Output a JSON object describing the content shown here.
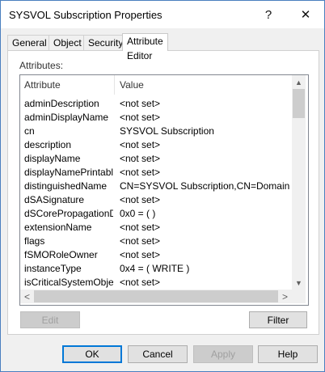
{
  "window": {
    "title": "SYSVOL Subscription Properties",
    "help_glyph": "?",
    "close_glyph": "✕"
  },
  "tabs": [
    {
      "label": "General"
    },
    {
      "label": "Object"
    },
    {
      "label": "Security"
    },
    {
      "label": "Attribute Editor",
      "active": true
    }
  ],
  "editor": {
    "section_label": "Attributes:",
    "columns": {
      "attribute": "Attribute",
      "value": "Value"
    },
    "rows": [
      {
        "name": "adminDescription",
        "value": "<not set>"
      },
      {
        "name": "adminDisplayName",
        "value": "<not set>"
      },
      {
        "name": "cn",
        "value": "SYSVOL Subscription"
      },
      {
        "name": "description",
        "value": "<not set>"
      },
      {
        "name": "displayName",
        "value": "<not set>"
      },
      {
        "name": "displayNamePrintable",
        "value": "<not set>"
      },
      {
        "name": "distinguishedName",
        "value": "CN=SYSVOL Subscription,CN=Domain System"
      },
      {
        "name": "dSASignature",
        "value": "<not set>"
      },
      {
        "name": "dSCorePropagationD...",
        "value": "0x0 = ( )"
      },
      {
        "name": "extensionName",
        "value": "<not set>"
      },
      {
        "name": "flags",
        "value": "<not set>"
      },
      {
        "name": "fSMORoleOwner",
        "value": "<not set>"
      },
      {
        "name": "instanceType",
        "value": "0x4 = ( WRITE )"
      },
      {
        "name": "isCriticalSystemObject",
        "value": "<not set>"
      }
    ],
    "scroll": {
      "up": "▲",
      "down": "▼",
      "left": "<",
      "right": ">"
    },
    "edit_label": "Edit",
    "filter_label": "Filter"
  },
  "footer": {
    "ok_label": "OK",
    "cancel_label": "Cancel",
    "apply_label": "Apply",
    "help_label": "Help"
  }
}
